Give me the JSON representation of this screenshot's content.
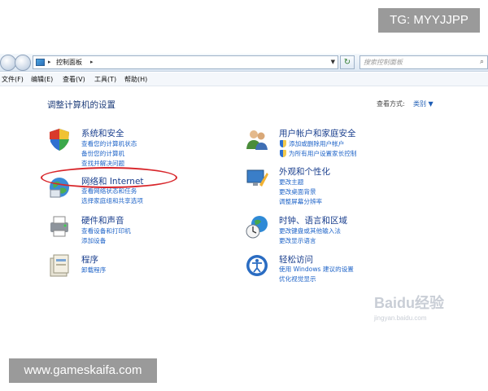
{
  "tg_badge": "TG: MYYJJPP",
  "address": {
    "crumb": "控制面板",
    "search_placeholder": "搜索控制面板"
  },
  "menu": [
    "文件(F)",
    "编辑(E)",
    "查看(V)",
    "工具(T)",
    "帮助(H)"
  ],
  "page_title": "调整计算机的设置",
  "view_by": {
    "label": "查看方式:",
    "value": "类别 ▼"
  },
  "categories": {
    "system": {
      "title": "系统和安全",
      "links": [
        "查看您的计算机状态",
        "备份您的计算机",
        "查找并解决问题"
      ]
    },
    "network": {
      "title": "网络和 Internet",
      "links": [
        "查看网络状态和任务",
        "选择家庭组和共享选项"
      ]
    },
    "hardware": {
      "title": "硬件和声音",
      "links": [
        "查看设备和打印机",
        "添加设备"
      ]
    },
    "programs": {
      "title": "程序",
      "links": [
        "卸载程序"
      ]
    },
    "users": {
      "title": "用户帐户和家庭安全",
      "links": [
        "添加或删除用户帐户",
        "为所有用户设置家长控制"
      ]
    },
    "appearance": {
      "title": "外观和个性化",
      "links": [
        "更改主题",
        "更改桌面背景",
        "调整屏幕分辨率"
      ]
    },
    "clock": {
      "title": "时钟、语言和区域",
      "links": [
        "更改键盘或其他输入法",
        "更改显示语言"
      ]
    },
    "ease": {
      "title": "轻松访问",
      "links": [
        "使用 Windows 建议的设置",
        "优化视觉显示"
      ]
    }
  },
  "watermark_bottom": "www.gameskaifa.com",
  "baidu_watermark": {
    "brand": "Baidu经验",
    "sub": "jingyan.baidu.com"
  }
}
